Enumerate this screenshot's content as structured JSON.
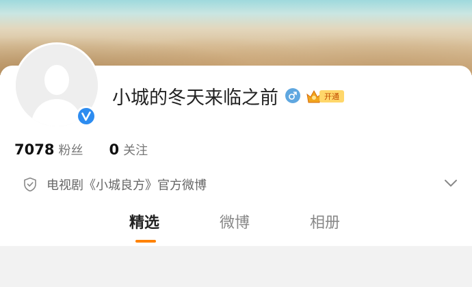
{
  "profile": {
    "username": "小城的冬天来临之前",
    "vip_badge_label": "开通",
    "gender_icon": "male-symbol-icon",
    "verified_icon": "verified-v-icon"
  },
  "stats": {
    "followers_count": "7078",
    "followers_label": "粉丝",
    "following_count": "0",
    "following_label": "关注"
  },
  "certification": {
    "text": "电视剧《小城良方》官方微博",
    "icon": "shield-check-icon"
  },
  "tabs": [
    {
      "label": "精选",
      "active": true
    },
    {
      "label": "微博",
      "active": false
    },
    {
      "label": "相册",
      "active": false
    }
  ],
  "colors": {
    "accent": "#ff8200",
    "verified_blue": "#2d8cf0",
    "gender_blue": "#5fa7e0",
    "vip_gold": "#ffd76a"
  }
}
